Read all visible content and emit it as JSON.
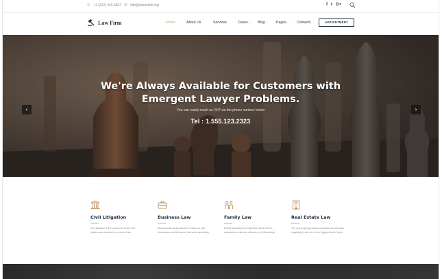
{
  "topbar": {
    "phone": "+1 (222) 345-6847",
    "email": "info@demolink.org",
    "social": [
      "f",
      "t",
      "G+"
    ]
  },
  "navbar": {
    "logo_text": "Law Firm",
    "items": [
      {
        "label": "Home",
        "active": true
      },
      {
        "label": "About Us"
      },
      {
        "label": "Services"
      },
      {
        "label": "Cases",
        "dropdown": true
      },
      {
        "label": "Blog",
        "dropdown": true
      },
      {
        "label": "Pages",
        "dropdown": true
      },
      {
        "label": "Contacts"
      }
    ],
    "appointment_label": "APPOINTMENT"
  },
  "hero": {
    "title_line1": "We're Always Available for Customers with",
    "title_line2": "Emergent Lawyer Problems.",
    "subtitle": "You can easily reach us 24/7 via the phone number below",
    "tel": "Tel : 1.555.123.2323",
    "prev_label": "‹",
    "next_label": "›"
  },
  "services": [
    {
      "icon": "courthouse-icon",
      "title": "Civil Litigation",
      "text": "Civil litigation is the process in which civil matters are resolved in a court of law."
    },
    {
      "icon": "briefcase-icon",
      "title": "Business Law",
      "text": "Business law deals with the creation of new businesses and the issues that arise according."
    },
    {
      "icon": "family-icon",
      "title": "Family Law",
      "text": "Family law attorneys help their clients file for separation or divorce, alimony or child custody."
    },
    {
      "icon": "building-icon",
      "title": "Real Estate Law",
      "text": "The real property market increases and the laws regulating it are one of our biggest field of work."
    }
  ],
  "colors": {
    "accent": "#c9a66b",
    "navy": "#1f2a3c",
    "icon_brown": "#b07f3d"
  }
}
